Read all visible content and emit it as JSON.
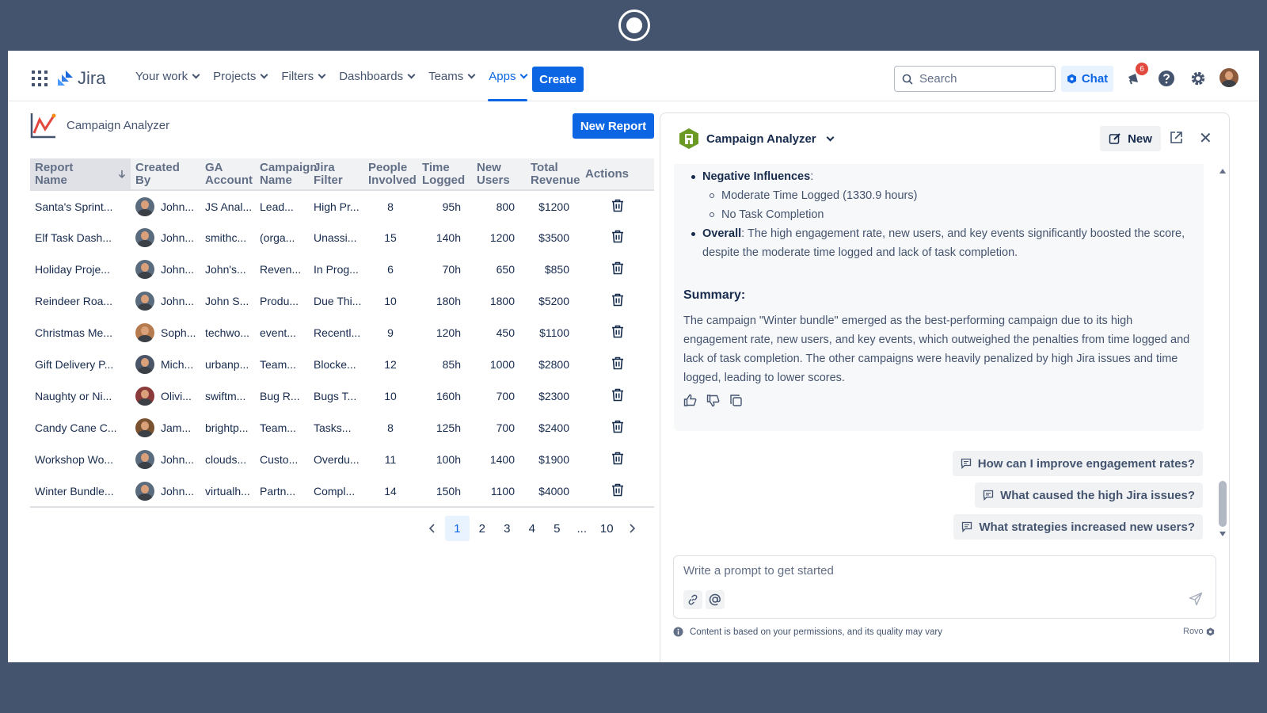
{
  "nav": {
    "product": "Jira",
    "links": [
      {
        "label": "Your work"
      },
      {
        "label": "Projects"
      },
      {
        "label": "Filters"
      },
      {
        "label": "Dashboards"
      },
      {
        "label": "Teams"
      },
      {
        "label": "Apps",
        "active": true
      }
    ],
    "create_label": "Create",
    "search_placeholder": "Search",
    "chat_label": "Chat",
    "notification_count": "6"
  },
  "page": {
    "title": "Campaign Analyzer",
    "new_report_label": "New Report"
  },
  "table": {
    "headers": {
      "report_name": "Report Name",
      "created_by": "Created By",
      "ga_account": "GA Account",
      "campaign_name": "Campaign Name",
      "jira_filter": "Jira Filter",
      "people_involved": "People Involved",
      "time_logged": "Time Logged",
      "new_users": "New Users",
      "total_revenue": "Total Revenue",
      "actions": "Actions"
    },
    "rows": [
      {
        "report": "Santa's Sprint...",
        "creator": "John...",
        "ga": "JS Anal...",
        "campaign": "Lead...",
        "filter": "High Pr...",
        "people": "8",
        "time": "95h",
        "users": "800",
        "revenue": "$1200"
      },
      {
        "report": "Elf Task Dash...",
        "creator": "John...",
        "ga": "smithc...",
        "campaign": "(orga...",
        "filter": "Unassi...",
        "people": "15",
        "time": "140h",
        "users": "1200",
        "revenue": "$3500"
      },
      {
        "report": "Holiday Proje...",
        "creator": "John...",
        "ga": "John's...",
        "campaign": "Reven...",
        "filter": "In Prog...",
        "people": "6",
        "time": "70h",
        "users": "650",
        "revenue": "$850"
      },
      {
        "report": "Reindeer Roa...",
        "creator": "John...",
        "ga": "John S...",
        "campaign": "Produ...",
        "filter": "Due Thi...",
        "people": "10",
        "time": "180h",
        "users": "1800",
        "revenue": "$5200"
      },
      {
        "report": "Christmas Me...",
        "creator": "Soph...",
        "ga": "techwo...",
        "campaign": "event...",
        "filter": "Recentl...",
        "people": "9",
        "time": "120h",
        "users": "450",
        "revenue": "$1100"
      },
      {
        "report": "Gift Delivery P...",
        "creator": "Mich...",
        "ga": "urbanp...",
        "campaign": "Team...",
        "filter": "Blocke...",
        "people": "12",
        "time": "85h",
        "users": "1000",
        "revenue": "$2800"
      },
      {
        "report": "Naughty or Ni...",
        "creator": "Olivi...",
        "ga": "swiftm...",
        "campaign": "Bug R...",
        "filter": "Bugs T...",
        "people": "10",
        "time": "160h",
        "users": "700",
        "revenue": "$2300"
      },
      {
        "report": "Candy Cane C...",
        "creator": "Jam...",
        "ga": "brightp...",
        "campaign": "Team...",
        "filter": "Tasks...",
        "people": "8",
        "time": "125h",
        "users": "700",
        "revenue": "$2400"
      },
      {
        "report": "Workshop Wo...",
        "creator": "John...",
        "ga": "clouds...",
        "campaign": "Custo...",
        "filter": "Overdu...",
        "people": "11",
        "time": "100h",
        "users": "1400",
        "revenue": "$1900"
      },
      {
        "report": "Winter Bundle...",
        "creator": "John...",
        "ga": "virtualh...",
        "campaign": "Partn...",
        "filter": "Compl...",
        "people": "14",
        "time": "150h",
        "users": "1100",
        "revenue": "$4000"
      }
    ]
  },
  "pagination": {
    "pages": [
      "1",
      "2",
      "3",
      "4",
      "5",
      "...",
      "10"
    ],
    "current": "1"
  },
  "panel": {
    "agent_name": "Campaign Analyzer",
    "new_label": "New",
    "negative_label": "Negative Influences",
    "negative_items": [
      "Moderate Time Logged (1330.9 hours)",
      "No Task Completion"
    ],
    "overall_label": "Overall",
    "overall_text": ": The high engagement rate, new users, and key events significantly boosted the score, despite the moderate time logged and lack of task completion.",
    "summary_heading": "Summary:",
    "summary_text": "The campaign \"Winter bundle\" emerged as the best-performing campaign due to its high engagement rate, new users, and key events, which outweighed the penalties from time logged and lack of task completion. The other campaigns were heavily penalized by high Jira issues and time logged, leading to lower scores.",
    "suggestions": [
      "How can I improve engagement rates?",
      "What caused the high Jira issues?",
      "What strategies increased new users?"
    ],
    "prompt_placeholder": "Write a prompt to get started",
    "disclaimer": "Content is based on your permissions, and its quality may vary",
    "brand": "Rovo"
  },
  "colors": {
    "accent": "#0c66e4",
    "frame": "#44546f",
    "badge": "#e2483d"
  }
}
